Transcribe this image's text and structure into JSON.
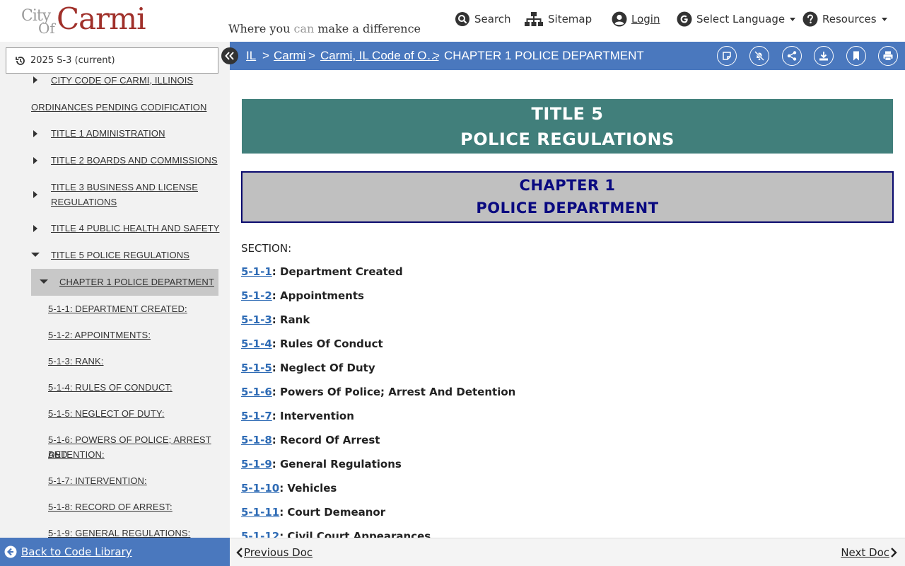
{
  "header": {
    "logo_city": "City",
    "logo_of": "Of",
    "logo_name": "Carmi",
    "tagline_1": "Where you ",
    "tagline_can": "can",
    "tagline_2": " make a difference",
    "nav": {
      "search": "Search",
      "sitemap": "Sitemap",
      "login": "Login",
      "language": "Select Language",
      "resources": "Resources"
    }
  },
  "sidebar": {
    "version": "2025 S-3 (current)",
    "toc": {
      "city_code": "CITY CODE OF CARMI, ILLINOIS",
      "ordinances": "ORDINANCES PENDING CODIFICATION",
      "t1": "TITLE 1 ADMINISTRATION",
      "t2": "TITLE 2 BOARDS AND COMMISSIONS",
      "t3a": "TITLE 3 BUSINESS AND LICENSE",
      "t3b": "REGULATIONS",
      "t4": "TITLE 4 PUBLIC HEALTH AND SAFETY",
      "t5": "TITLE 5 POLICE REGULATIONS",
      "ch1": "CHAPTER 1 POLICE DEPARTMENT",
      "s1": "5-1-1: DEPARTMENT CREATED:",
      "s2": "5-1-2: APPOINTMENTS:",
      "s3": "5-1-3: RANK:",
      "s4": "5-1-4: RULES OF CONDUCT:",
      "s5": "5-1-5: NEGLECT OF DUTY:",
      "s6a": "5-1-6: POWERS OF POLICE; ARREST AND",
      "s6b": "DETENTION:",
      "s7": "5-1-7: INTERVENTION:",
      "s8": "5-1-8: RECORD OF ARREST:",
      "s9": "5-1-9: GENERAL REGULATIONS:"
    },
    "back": "Back to Code Library"
  },
  "breadcrumb": {
    "il": "IL",
    "sep": ">",
    "carmi": "Carmi",
    "code": "Carmi, IL Code of O…",
    "current": "CHAPTER 1 POLICE DEPARTMENT"
  },
  "content": {
    "title_line1": "TITLE 5",
    "title_line2": "POLICE REGULATIONS",
    "chapter_line1": "CHAPTER 1",
    "chapter_line2": "POLICE DEPARTMENT",
    "section_label": "SECTION:",
    "sections": [
      {
        "num": "5-1-1",
        "title": ": Department Created"
      },
      {
        "num": "5-1-2",
        "title": ": Appointments"
      },
      {
        "num": "5-1-3",
        "title": ": Rank"
      },
      {
        "num": "5-1-4",
        "title": ": Rules Of Conduct"
      },
      {
        "num": "5-1-5",
        "title": ": Neglect Of Duty"
      },
      {
        "num": "5-1-6",
        "title": ": Powers Of Police; Arrest And Detention"
      },
      {
        "num": "5-1-7",
        "title": ": Intervention"
      },
      {
        "num": "5-1-8",
        "title": ": Record Of Arrest"
      },
      {
        "num": "5-1-9",
        "title": ": General Regulations"
      },
      {
        "num": "5-1-10",
        "title": ": Vehicles"
      },
      {
        "num": "5-1-11",
        "title": ": Court Demeanor"
      },
      {
        "num": "5-1-12",
        "title": ": Civil Court Appearances"
      }
    ]
  },
  "footer": {
    "prev": "Previous Doc",
    "next": "Next Doc"
  },
  "colors": {
    "brand_red": "#a0302a",
    "blue_bar": "#4a78be",
    "title_teal": "#417f7b",
    "chapter_navy": "#0a0a80",
    "link_blue": "#2e6bb5"
  }
}
